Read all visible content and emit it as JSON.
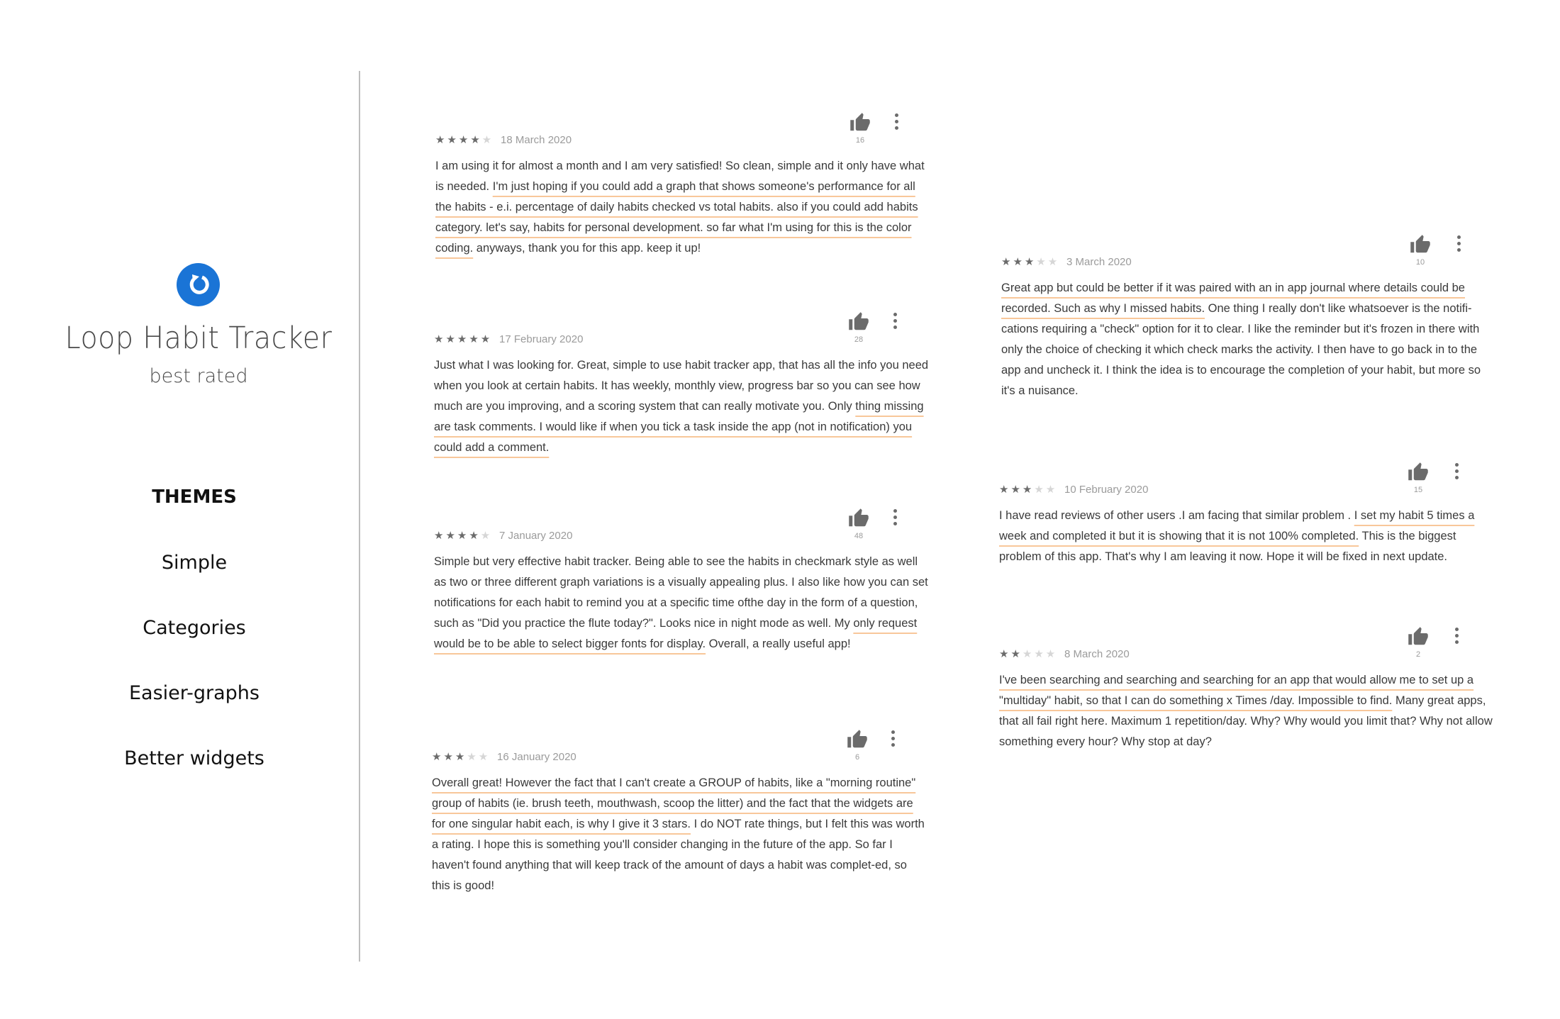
{
  "sidebar": {
    "app_title": "Loop Habit Tracker",
    "subtitle": "best rated",
    "logo_icon": "loop-arrow-icon",
    "logo_color": "#1a74d6",
    "themes_heading": "THEMES",
    "themes": [
      "Simple",
      "Categories",
      "Easier-graphs",
      "Better widgets"
    ]
  },
  "colors": {
    "highlight_underline": "#f8c79a",
    "star_filled": "#6b6b6b",
    "star_empty": "#d6d6d6"
  },
  "reviews": [
    {
      "rating": 4,
      "stars": "★★★★",
      "stars_off": "★",
      "date": "18 March 2020",
      "likes": "16",
      "segments": [
        {
          "t": "I am using it for almost a month and I am very satisfied! So clean, simple and it only have what is needed. ",
          "hl": false
        },
        {
          "t": "I'm just hoping if you could add a graph that shows someone's performance for all the habits - e.i. percentage of daily habits checked vs total habits. also if you could add habits category. let's say, habits for personal development. so far what I'm using for this is the color coding.",
          "hl": true
        },
        {
          "t": " anyways, thank you for this app. keep it up!",
          "hl": false
        }
      ]
    },
    {
      "rating": 5,
      "stars": "★★★★★",
      "stars_off": "",
      "date": "17 February 2020",
      "likes": "28",
      "segments": [
        {
          "t": "Just what I was looking for. Great, simple to use habit tracker app, that has all the info you need when you look at certain habits. It has weekly, monthly view, progress bar so you can see how much are you improving, and a scoring system that can really motivate you. Only ",
          "hl": false
        },
        {
          "t": "thing missing are task comments. I would like if when you tick a task inside the app (not in notification) you could add a comment.",
          "hl": true
        }
      ]
    },
    {
      "rating": 4,
      "stars": "★★★★",
      "stars_off": "★",
      "date": "7 January 2020",
      "likes": "48",
      "segments": [
        {
          "t": "Simple but very effective habit tracker. Being able to see the habits in checkmark style as well as two or three different graph variations is a visually appealing plus. I also like how you can set notifications for each habit to remind you at a specific time ofthe day in the form of a question, such as \"Did you practice the flute today?\". Looks nice in night mode as well. My ",
          "hl": false
        },
        {
          "t": "only request would be to be able to select bigger fonts for display.",
          "hl": true
        },
        {
          "t": " Overall, a really useful app!",
          "hl": false
        }
      ]
    },
    {
      "rating": 3,
      "stars": "★★★",
      "stars_off": "★★",
      "date": "16 January 2020",
      "likes": "6",
      "segments": [
        {
          "t": "Overall great! However the fact that I can't create a GROUP of habits, like a \"morning routine\" group of habits (ie. brush teeth, mouthwash, scoop the litter) and the fact that the widgets are for one singular habit each, is why I give it 3 stars.",
          "hl": true
        },
        {
          "t": " I do NOT rate things, but I felt this was worth a rating. I hope this is something you'll consider changing in the future of the app. So far I haven't found anything that will keep track of the amount of days a habit was complet-ed, so this is good!",
          "hl": false
        }
      ]
    },
    {
      "rating": 3,
      "stars": "★★★",
      "stars_off": "★★",
      "date": "3 March 2020",
      "likes": "10",
      "segments": [
        {
          "t": "Great app but could be better if it was paired with an in app journal where details could be recorded. Such as why I missed habits.",
          "hl": true
        },
        {
          "t": " One thing I really don't like whatsoever is the notifi-cations requiring a \"check\" option for it to clear. I like the reminder but it's frozen in there with only the choice of checking it which check marks the activity. I then have to go back in to the app and uncheck it. I think the idea is to encourage the completion of your habit, but more so it's a nuisance.",
          "hl": false
        }
      ]
    },
    {
      "rating": 3,
      "stars": "★★★",
      "stars_off": "★★",
      "date": "10 February 2020",
      "likes": "15",
      "segments": [
        {
          "t": "I have read reviews of other users .I am facing that similar problem . ",
          "hl": false
        },
        {
          "t": "I set my habit 5 times a week and completed it but it is showing that it is not 100% completed.",
          "hl": true
        },
        {
          "t": " This is the biggest problem of this app. That's why I am leaving it now. Hope it will be fixed in next update.",
          "hl": false
        }
      ]
    },
    {
      "rating": 2,
      "stars": "★★",
      "stars_off": "★★★",
      "date": "8 March 2020",
      "likes": "2",
      "segments": [
        {
          "t": "I've been searching and searching and searching for an app that would allow me to set up a \"multiday\" habit, so that I can do something x Times /day. Impossible to find.",
          "hl": true
        },
        {
          "t": " Many great apps, that all fail right here. Maximum 1 repetition/day. Why? Why would you limit that? Why not allow something every hour? Why stop at day?",
          "hl": false
        }
      ]
    }
  ]
}
